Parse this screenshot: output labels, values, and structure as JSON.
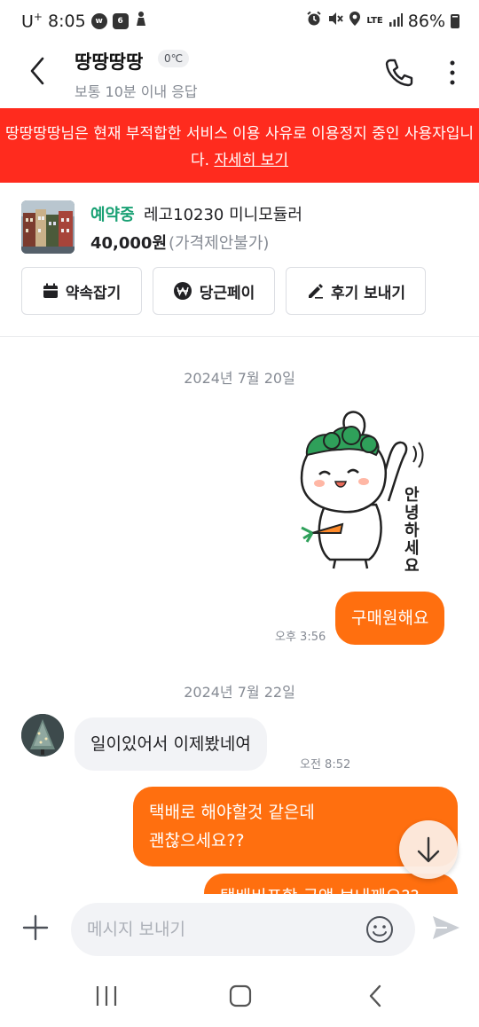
{
  "status_bar": {
    "carrier": "U",
    "carrier_sup": "+",
    "time": "8:05",
    "notif_icons": [
      "wavve-icon",
      "calendar-icon",
      "gesture-icon"
    ],
    "calendar_day": "6",
    "network": "LTE",
    "battery": "86%"
  },
  "header": {
    "name": "땅땅땅땅",
    "temperature": "0℃",
    "response": "보통 10분 이내 응답"
  },
  "banner": {
    "text": "땅땅땅땅님은 현재 부적합한 서비스 이용 사유로 이용정지 중인 사용자입니다.",
    "link": "자세히 보기",
    "color": "#ff2b1e"
  },
  "product": {
    "status": "예약중",
    "title": "레고10230 미니모듈러",
    "price": "40,000원",
    "price_note": "(가격제안불가)",
    "actions": [
      {
        "label": "약속잡기",
        "icon": "calendar-icon"
      },
      {
        "label": "당근페이",
        "icon": "won-icon"
      },
      {
        "label": "후기 보내기",
        "icon": "pencil-icon"
      }
    ]
  },
  "chat": {
    "dates": [
      "2024년 7월 20일",
      "2024년 7월 22일"
    ],
    "sticker_text": "안녕하세요",
    "messages": [
      {
        "from": "me",
        "lines": [
          "구매원해요"
        ],
        "time": "오후 3:56"
      },
      {
        "from": "them",
        "lines": [
          "일이있어서 이제봤네여"
        ],
        "time": "오전 8:52"
      },
      {
        "from": "me",
        "lines": [
          "택배로 해야할것 같은데",
          "괜찮으세요??"
        ]
      },
      {
        "from": "me",
        "lines": [
          "택배비포함 금액 보내께요??"
        ]
      }
    ]
  },
  "input": {
    "placeholder": "메시지 보내기"
  },
  "colors": {
    "accent": "#ff6f0f",
    "status_green": "#1aa174"
  }
}
